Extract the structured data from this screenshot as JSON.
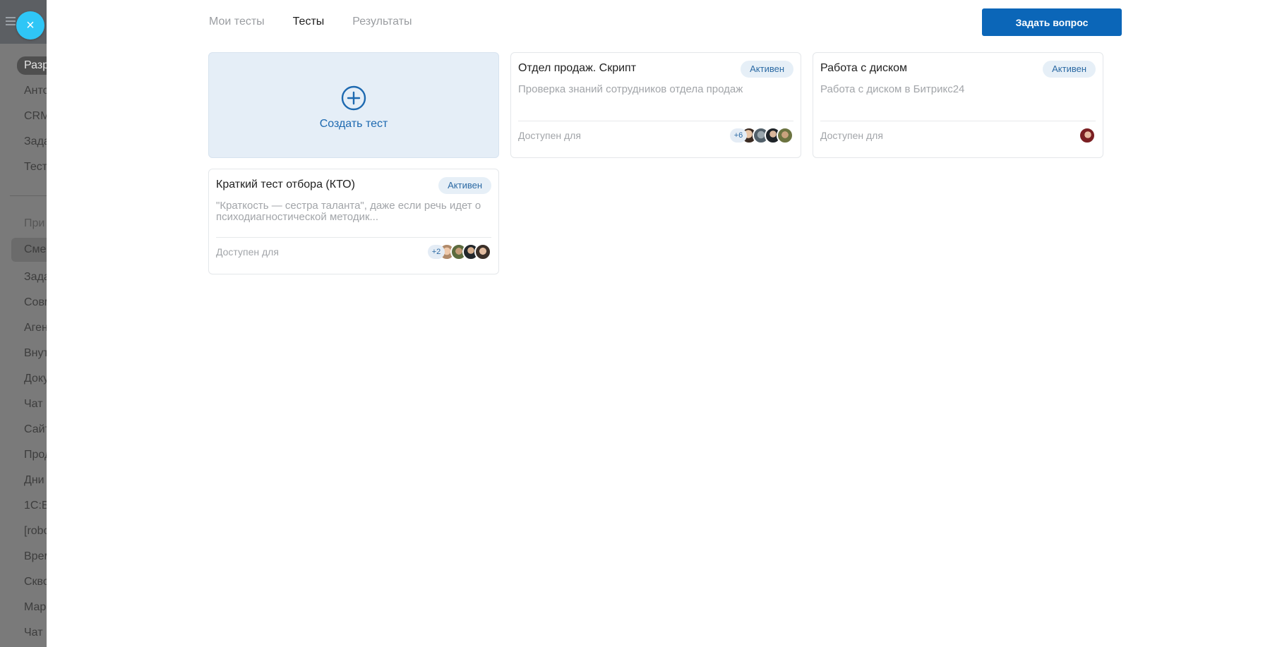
{
  "background_sidebar": {
    "items": [
      {
        "label": "Разр",
        "top": 0
      },
      {
        "label": "Анто"
      },
      {
        "label": "CRM"
      },
      {
        "label": "Зада"
      },
      {
        "label": "Тест"
      },
      {
        "label": "При"
      },
      {
        "label": "Смен"
      },
      {
        "label": "Зада"
      },
      {
        "label": "Совм"
      },
      {
        "label": "Аген"
      },
      {
        "label": "Внут"
      },
      {
        "label": "Доку"
      },
      {
        "label": "Чат"
      },
      {
        "label": "Сайт"
      },
      {
        "label": "Прод"
      },
      {
        "label": "Дни"
      },
      {
        "label": "1С:Б"
      },
      {
        "label": "[robo"
      },
      {
        "label": "Врем"
      },
      {
        "label": "Скво"
      },
      {
        "label": "Мар"
      },
      {
        "label": "Чат"
      }
    ]
  },
  "close_button": {
    "icon": "close-icon",
    "glyph": "×",
    "color": "#2fc6f6"
  },
  "tabs": [
    {
      "label": "Мои тесты",
      "active": false
    },
    {
      "label": "Тесты",
      "active": true
    },
    {
      "label": "Результаты",
      "active": false
    }
  ],
  "ask_button": {
    "label": "Задать вопрос",
    "color": "#0b66b8"
  },
  "create_card": {
    "label": "Создать тест",
    "icon": "plus-circle-icon"
  },
  "cards": [
    {
      "title": "Отдел продаж. Скрипт",
      "status": "Активен",
      "description": "Проверка знаний сотрудников отдела продаж",
      "footer": "Доступен для",
      "more": "+6"
    },
    {
      "title": "Работа с диском",
      "status": "Активен",
      "description": "Работа с диском в Битрикс24",
      "footer": "Доступен для",
      "more": ""
    },
    {
      "title": "Краткий тест отбора (КТО)",
      "status": "Активен",
      "description": "\"Краткость — сестра таланта\", даже если речь идет о психодиагностической методик...",
      "footer": "Доступен для",
      "more": "+2"
    }
  ],
  "colors": {
    "accent": "#0b66b8",
    "badge_bg": "#e6eff7",
    "badge_text": "#2c6aa4",
    "create_bg": "#e5eef7"
  }
}
